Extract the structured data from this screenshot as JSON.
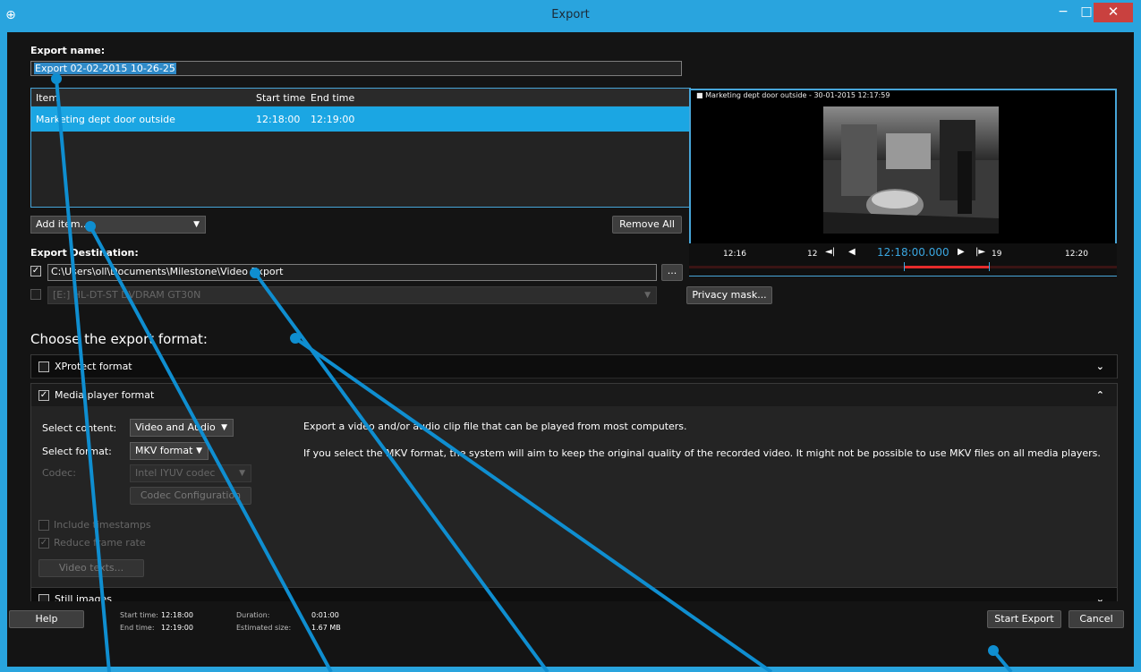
{
  "window": {
    "title": "Export",
    "minimize": "−",
    "maximize": "□",
    "close": "✕"
  },
  "export_name": {
    "label": "Export name:",
    "value": "Export 02-02-2015 10-26-25"
  },
  "items_table": {
    "headers": [
      "Item",
      "Start time",
      "End time"
    ],
    "rows": [
      {
        "item": "Marketing dept door outside",
        "start": "12:18:00",
        "end": "12:19:00"
      }
    ]
  },
  "add_item": {
    "label": "Add item..."
  },
  "remove_all": {
    "label": "Remove All"
  },
  "export_destination": {
    "label": "Export Destination:",
    "path": "C:\\Users\\oll\\Documents\\Milestone\\Video Export",
    "browse": "...",
    "drive": "[E:] HL-DT-ST DVDRAM GT30N"
  },
  "preview": {
    "camera_title": "Marketing dept door outside - 30-01-2015 12:17:59",
    "current_time": "12:18:00.000",
    "ticks": [
      "12:16",
      "12",
      "19",
      "12:20"
    ]
  },
  "privacy_mask": {
    "label": "Privacy mask..."
  },
  "choose_format": {
    "title": "Choose the export format:"
  },
  "formats": {
    "xprotect": {
      "label": "XProtect format",
      "checked": false
    },
    "media_player": {
      "label": "Media player format",
      "checked": true,
      "select_content_label": "Select content:",
      "select_content_value": "Video and Audio",
      "select_format_label": "Select format:",
      "select_format_value": "MKV format",
      "codec_label": "Codec:",
      "codec_value": "Intel IYUV codec",
      "codec_config": "Codec Configuration",
      "include_timestamps": "Include timestamps",
      "reduce_frame_rate": "Reduce frame rate",
      "video_texts": "Video texts...",
      "description_1": "Export a video and/or audio clip file that can be played from most computers.",
      "description_2": "If you select the MKV format, the system will aim to keep the original quality of the recorded video. It might not be possible to use MKV files on all media players."
    },
    "still_images": {
      "label": "Still images",
      "checked": false
    }
  },
  "footer": {
    "help": "Help",
    "start_time_label": "Start time:",
    "start_time": "12:18:00",
    "end_time_label": "End time:",
    "end_time": "12:19:00",
    "duration_label": "Duration:",
    "duration": "0:01:00",
    "estimated_size_label": "Estimated size:",
    "estimated_size": "1.67 MB",
    "start_export": "Start Export",
    "cancel": "Cancel"
  },
  "colors": {
    "accent": "#1ba6e3",
    "titlebar": "#29a4de",
    "close": "#c9413f",
    "background": "#141414"
  }
}
